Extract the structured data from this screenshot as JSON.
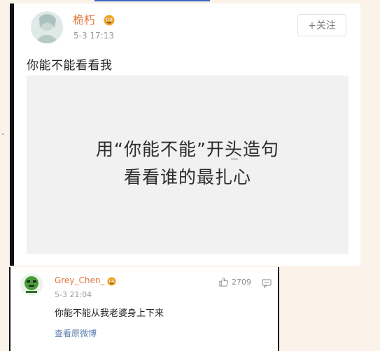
{
  "post": {
    "author": "桅朽",
    "time": "5-3 17:13",
    "follow_label": "+关注",
    "text": "你能不能看看我",
    "image_lines": [
      "用“你能不能”开头造句",
      "看看谁的最扎心"
    ]
  },
  "comment": {
    "author": "Grey_Chen_",
    "time": "5-3 21:04",
    "likes": "2709",
    "text": "你能不能从我老婆身上下来",
    "view_original": "查看原微博"
  },
  "colors": {
    "author": "#e3773e",
    "link": "#5a7cae",
    "badge": "#f0a528"
  }
}
